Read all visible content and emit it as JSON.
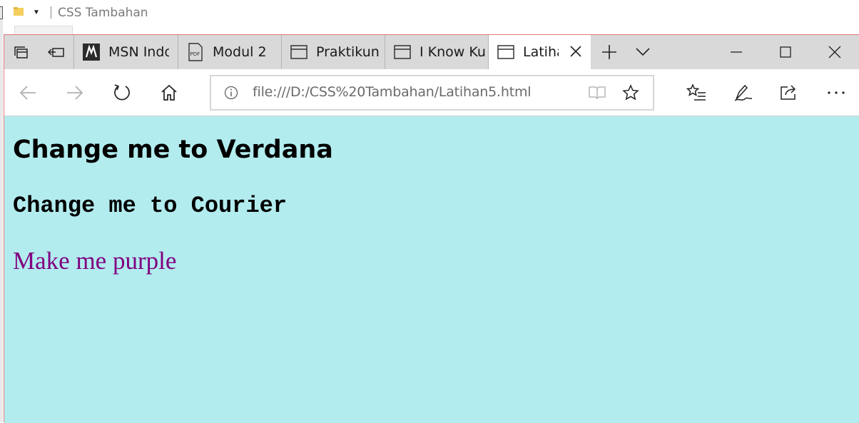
{
  "explorer": {
    "title": "CSS Tambahan"
  },
  "tabs": [
    {
      "label": "MSN Indo",
      "icon": "msn-icon"
    },
    {
      "label": "Modul 2",
      "icon": "pdf-icon"
    },
    {
      "label": "Praktikun",
      "icon": "page-icon"
    },
    {
      "label": "I Know Ku",
      "icon": "page-icon"
    },
    {
      "label": "Latiha",
      "icon": "page-icon",
      "active": true
    }
  ],
  "address": {
    "url": "file:///D:/CSS%20Tambahan/Latihan5.html"
  },
  "page": {
    "background": "#b2ecee",
    "heading_verdana": "Change me to Verdana",
    "heading_courier": "Change me to Courier",
    "paragraph_purple": "Make me purple",
    "purple_color": "#800080"
  }
}
